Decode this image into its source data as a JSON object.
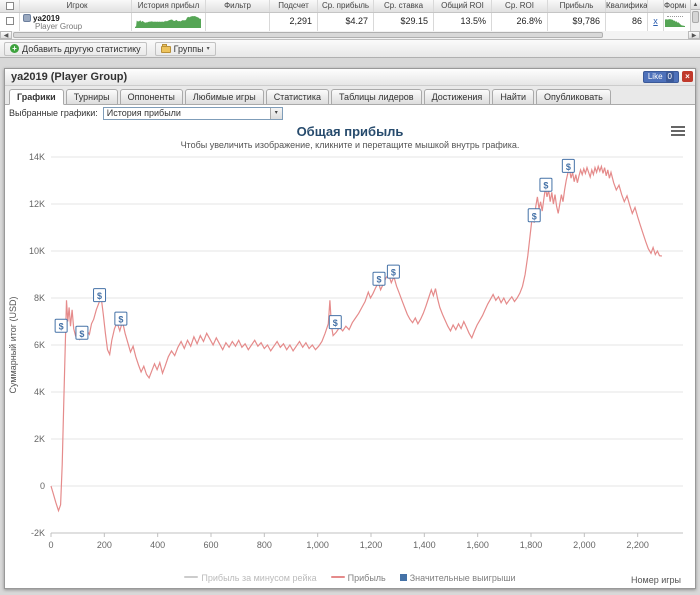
{
  "icons": {
    "close": "×",
    "plus": "+",
    "caret_down": "▾",
    "left": "◀",
    "right": "▶",
    "up": "▲"
  },
  "table": {
    "headers": [
      "Игрок",
      "История прибыл",
      "Фильтр",
      "Подсчет",
      "Ср. прибыль",
      "Ср. ставка",
      "Общий ROI",
      "Ср. ROI",
      "Прибыль",
      "Квалификаци",
      "Форма"
    ],
    "row": {
      "name": "ya2019",
      "group": "Player Group",
      "filter": "",
      "count": "2,291",
      "avg_profit": "$4.27",
      "avg_stake": "$29.15",
      "total_roi": "13.5%",
      "avg_roi": "26.8%",
      "profit": "$9,786",
      "qualification": "86",
      "link": "x",
      "sparkline_color": "#55a555"
    }
  },
  "toolbar": {
    "add_stat": "Добавить другую статистику",
    "groups": "Группы"
  },
  "panel": {
    "title": "ya2019 (Player Group)",
    "like_label": "Like",
    "like_count": "0",
    "tabs": [
      "Графики",
      "Турниры",
      "Оппоненты",
      "Любимые игры",
      "Статистика",
      "Таблицы лидеров",
      "Достижения",
      "Найти",
      "Опубликовать"
    ],
    "graphs_label": "Выбранные графики:",
    "graph_selected": "История прибыли"
  },
  "chart_data": {
    "type": "line",
    "title": "Общая прибыль",
    "subtitle": "Чтобы увеличить изображение, кликните и перетащите мышкой внутрь графика.",
    "xlabel": "Номер игры",
    "ylabel": "Суммарный итог (USD)",
    "xlim": [
      0,
      2370
    ],
    "ylim": [
      -2000,
      14000
    ],
    "grid": true,
    "legend_position": "bottom",
    "line_color": "#E58B8B",
    "flag_color": "#4572A7",
    "flag_label": "$",
    "xticks": [
      {
        "v": 0,
        "label": "0"
      },
      {
        "v": 200,
        "label": "200"
      },
      {
        "v": 400,
        "label": "400"
      },
      {
        "v": 600,
        "label": "600"
      },
      {
        "v": 800,
        "label": "800"
      },
      {
        "v": 1000,
        "label": "1,000"
      },
      {
        "v": 1200,
        "label": "1,200"
      },
      {
        "v": 1400,
        "label": "1,400"
      },
      {
        "v": 1600,
        "label": "1,600"
      },
      {
        "v": 1800,
        "label": "1,800"
      },
      {
        "v": 2000,
        "label": "2,000"
      },
      {
        "v": 2200,
        "label": "2,200"
      }
    ],
    "yticks": [
      {
        "v": -2000,
        "label": "-2K"
      },
      {
        "v": 0,
        "label": "0"
      },
      {
        "v": 2000,
        "label": "2K"
      },
      {
        "v": 4000,
        "label": "4K"
      },
      {
        "v": 6000,
        "label": "6K"
      },
      {
        "v": 8000,
        "label": "8K"
      },
      {
        "v": 10000,
        "label": "10K"
      },
      {
        "v": 12000,
        "label": "12K"
      },
      {
        "v": 14000,
        "label": "14K"
      }
    ],
    "legend": [
      {
        "label": "Прибыль за минусом рейка",
        "color": "#CCCCCC",
        "symbol": "line",
        "disabled": true
      },
      {
        "label": "Прибыль",
        "color": "#E58B8B",
        "symbol": "line",
        "disabled": false
      },
      {
        "label": "Значительные выигрыши",
        "color": "#4572A7",
        "symbol": "square",
        "disabled": false
      }
    ],
    "series": [
      {
        "name": "Прибыль",
        "points": [
          [
            0,
            0
          ],
          [
            8,
            -300
          ],
          [
            18,
            -700
          ],
          [
            28,
            -1050
          ],
          [
            36,
            -800
          ],
          [
            42,
            900
          ],
          [
            48,
            3600
          ],
          [
            54,
            6200
          ],
          [
            58,
            7900
          ],
          [
            63,
            7000
          ],
          [
            68,
            7600
          ],
          [
            73,
            6800
          ],
          [
            79,
            7500
          ],
          [
            85,
            6700
          ],
          [
            92,
            6400
          ],
          [
            100,
            6500
          ],
          [
            108,
            6250
          ],
          [
            118,
            6550
          ],
          [
            126,
            6350
          ],
          [
            135,
            6600
          ],
          [
            144,
            6450
          ],
          [
            152,
            6900
          ],
          [
            160,
            7100
          ],
          [
            170,
            7500
          ],
          [
            180,
            7800
          ],
          [
            188,
            8050
          ],
          [
            196,
            7300
          ],
          [
            204,
            6500
          ],
          [
            212,
            5800
          ],
          [
            220,
            5600
          ],
          [
            228,
            6200
          ],
          [
            238,
            6700
          ],
          [
            248,
            6950
          ],
          [
            258,
            6600
          ],
          [
            268,
            7000
          ],
          [
            278,
            6500
          ],
          [
            288,
            6100
          ],
          [
            298,
            5700
          ],
          [
            308,
            5950
          ],
          [
            318,
            5500
          ],
          [
            328,
            5150
          ],
          [
            338,
            4850
          ],
          [
            348,
            5100
          ],
          [
            358,
            4750
          ],
          [
            368,
            4600
          ],
          [
            378,
            4900
          ],
          [
            388,
            5200
          ],
          [
            398,
            4950
          ],
          [
            408,
            5250
          ],
          [
            418,
            4800
          ],
          [
            428,
            5100
          ],
          [
            440,
            5500
          ],
          [
            452,
            5750
          ],
          [
            464,
            5550
          ],
          [
            476,
            5900
          ],
          [
            488,
            6150
          ],
          [
            500,
            5850
          ],
          [
            512,
            6200
          ],
          [
            524,
            5950
          ],
          [
            536,
            6350
          ],
          [
            548,
            6050
          ],
          [
            560,
            6400
          ],
          [
            572,
            6150
          ],
          [
            584,
            6500
          ],
          [
            596,
            6250
          ],
          [
            608,
            6000
          ],
          [
            620,
            6300
          ],
          [
            632,
            6050
          ],
          [
            644,
            5800
          ],
          [
            656,
            6100
          ],
          [
            668,
            5900
          ],
          [
            680,
            6150
          ],
          [
            692,
            5950
          ],
          [
            704,
            6200
          ],
          [
            716,
            5900
          ],
          [
            728,
            6050
          ],
          [
            740,
            5800
          ],
          [
            752,
            6000
          ],
          [
            764,
            6200
          ],
          [
            776,
            5950
          ],
          [
            788,
            6100
          ],
          [
            800,
            5850
          ],
          [
            812,
            6000
          ],
          [
            824,
            5750
          ],
          [
            836,
            5950
          ],
          [
            848,
            6150
          ],
          [
            860,
            5900
          ],
          [
            872,
            6050
          ],
          [
            884,
            5800
          ],
          [
            896,
            6000
          ],
          [
            908,
            5750
          ],
          [
            920,
            5950
          ],
          [
            932,
            6150
          ],
          [
            944,
            5900
          ],
          [
            956,
            6100
          ],
          [
            968,
            5850
          ],
          [
            980,
            6000
          ],
          [
            992,
            5800
          ],
          [
            1004,
            5950
          ],
          [
            1016,
            6150
          ],
          [
            1028,
            6500
          ],
          [
            1040,
            6900
          ],
          [
            1046,
            7900
          ],
          [
            1052,
            6800
          ],
          [
            1058,
            6400
          ],
          [
            1070,
            6550
          ],
          [
            1082,
            6750
          ],
          [
            1094,
            6600
          ],
          [
            1106,
            6800
          ],
          [
            1118,
            6650
          ],
          [
            1130,
            6950
          ],
          [
            1142,
            7150
          ],
          [
            1154,
            7350
          ],
          [
            1166,
            7600
          ],
          [
            1178,
            7850
          ],
          [
            1190,
            8250
          ],
          [
            1198,
            8000
          ],
          [
            1208,
            8200
          ],
          [
            1218,
            8450
          ],
          [
            1228,
            8650
          ],
          [
            1236,
            8350
          ],
          [
            1246,
            8600
          ],
          [
            1256,
            8850
          ],
          [
            1266,
            9000
          ],
          [
            1276,
            8650
          ],
          [
            1286,
            8900
          ],
          [
            1296,
            8500
          ],
          [
            1306,
            8200
          ],
          [
            1316,
            7900
          ],
          [
            1326,
            7600
          ],
          [
            1336,
            7300
          ],
          [
            1346,
            7100
          ],
          [
            1356,
            6950
          ],
          [
            1366,
            7150
          ],
          [
            1376,
            6900
          ],
          [
            1386,
            7100
          ],
          [
            1396,
            7350
          ],
          [
            1406,
            7650
          ],
          [
            1416,
            8000
          ],
          [
            1426,
            8350
          ],
          [
            1434,
            8100
          ],
          [
            1442,
            8400
          ],
          [
            1450,
            7950
          ],
          [
            1458,
            7600
          ],
          [
            1468,
            7300
          ],
          [
            1478,
            7050
          ],
          [
            1488,
            6800
          ],
          [
            1498,
            6600
          ],
          [
            1508,
            6850
          ],
          [
            1518,
            6650
          ],
          [
            1528,
            6900
          ],
          [
            1538,
            6700
          ],
          [
            1548,
            7000
          ],
          [
            1558,
            6750
          ],
          [
            1568,
            6500
          ],
          [
            1578,
            6300
          ],
          [
            1588,
            6600
          ],
          [
            1598,
            6850
          ],
          [
            1608,
            7050
          ],
          [
            1618,
            7250
          ],
          [
            1628,
            7500
          ],
          [
            1638,
            7750
          ],
          [
            1648,
            7950
          ],
          [
            1658,
            8150
          ],
          [
            1668,
            7900
          ],
          [
            1678,
            8050
          ],
          [
            1688,
            7800
          ],
          [
            1698,
            8000
          ],
          [
            1708,
            7750
          ],
          [
            1718,
            7900
          ],
          [
            1728,
            8050
          ],
          [
            1738,
            7850
          ],
          [
            1748,
            8000
          ],
          [
            1758,
            8200
          ],
          [
            1768,
            8500
          ],
          [
            1778,
            9000
          ],
          [
            1788,
            9800
          ],
          [
            1794,
            10400
          ],
          [
            1800,
            11000
          ],
          [
            1806,
            11600
          ],
          [
            1812,
            11200
          ],
          [
            1818,
            11900
          ],
          [
            1824,
            12300
          ],
          [
            1830,
            11800
          ],
          [
            1836,
            12100
          ],
          [
            1842,
            11700
          ],
          [
            1848,
            12200
          ],
          [
            1854,
            12700
          ],
          [
            1860,
            12300
          ],
          [
            1866,
            12600
          ],
          [
            1872,
            12100
          ],
          [
            1878,
            12500
          ],
          [
            1884,
            12000
          ],
          [
            1890,
            12400
          ],
          [
            1896,
            11900
          ],
          [
            1902,
            11600
          ],
          [
            1908,
            12000
          ],
          [
            1914,
            12400
          ],
          [
            1920,
            12100
          ],
          [
            1926,
            12600
          ],
          [
            1932,
            13000
          ],
          [
            1938,
            13300
          ],
          [
            1944,
            13500
          ],
          [
            1950,
            13100
          ],
          [
            1956,
            13350
          ],
          [
            1962,
            12950
          ],
          [
            1968,
            13250
          ],
          [
            1974,
            12900
          ],
          [
            1980,
            13200
          ],
          [
            1986,
            13450
          ],
          [
            1992,
            13250
          ],
          [
            1998,
            13500
          ],
          [
            2004,
            13300
          ],
          [
            2010,
            13550
          ],
          [
            2016,
            13350
          ],
          [
            2022,
            13150
          ],
          [
            2028,
            13450
          ],
          [
            2034,
            13250
          ],
          [
            2040,
            13550
          ],
          [
            2046,
            13350
          ],
          [
            2052,
            13600
          ],
          [
            2058,
            13400
          ],
          [
            2064,
            13600
          ],
          [
            2070,
            13300
          ],
          [
            2076,
            13550
          ],
          [
            2082,
            13200
          ],
          [
            2088,
            13450
          ],
          [
            2094,
            13100
          ],
          [
            2100,
            13350
          ],
          [
            2110,
            12900
          ],
          [
            2120,
            12600
          ],
          [
            2130,
            12800
          ],
          [
            2140,
            12400
          ],
          [
            2150,
            12100
          ],
          [
            2160,
            12350
          ],
          [
            2170,
            11950
          ],
          [
            2180,
            11600
          ],
          [
            2190,
            11850
          ],
          [
            2200,
            11450
          ],
          [
            2210,
            11100
          ],
          [
            2220,
            10750
          ],
          [
            2230,
            10400
          ],
          [
            2240,
            10100
          ],
          [
            2250,
            9900
          ],
          [
            2258,
            10150
          ],
          [
            2266,
            9850
          ],
          [
            2274,
            10000
          ],
          [
            2282,
            9800
          ],
          [
            2291,
            9786
          ]
        ]
      }
    ],
    "significant_wins": [
      [
        38,
        6800
      ],
      [
        116,
        6500
      ],
      [
        182,
        8100
      ],
      [
        262,
        7100
      ],
      [
        1066,
        6950
      ],
      [
        1230,
        8800
      ],
      [
        1284,
        9100
      ],
      [
        1812,
        11500
      ],
      [
        1856,
        12800
      ],
      [
        1940,
        13600
      ]
    ]
  }
}
